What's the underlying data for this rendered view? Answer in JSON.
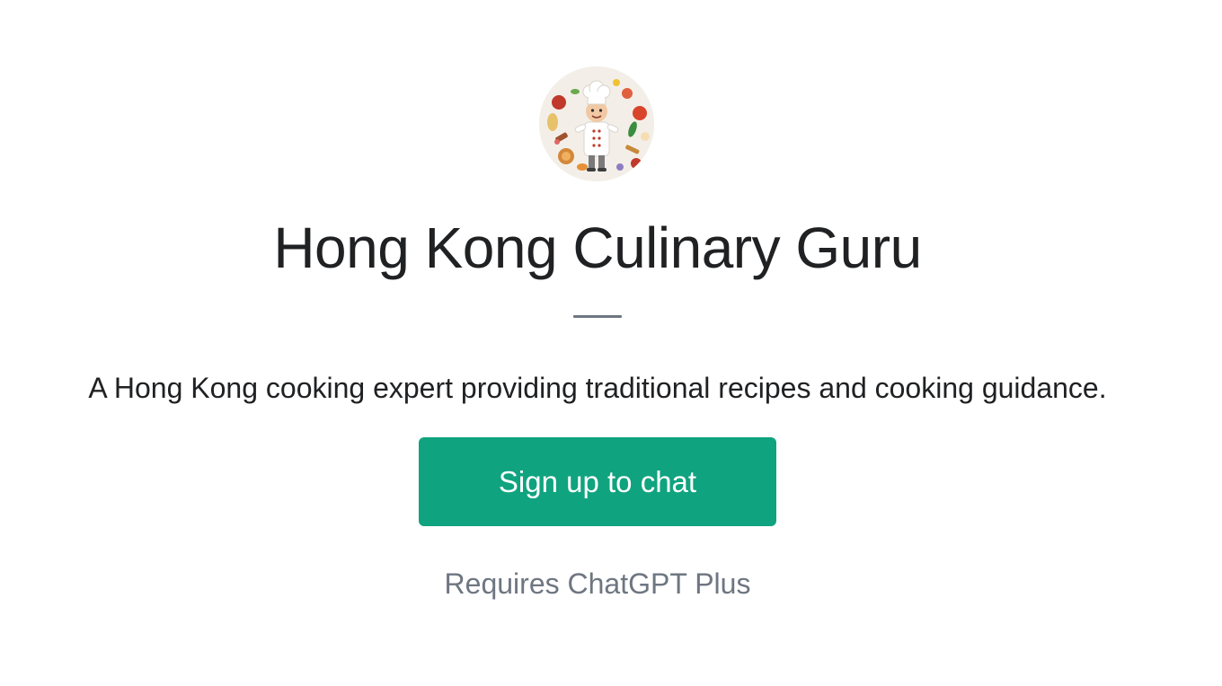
{
  "gpt": {
    "avatar_icon": "chef-illustration-icon",
    "title": "Hong Kong Culinary Guru",
    "description": "A Hong Kong cooking expert providing traditional recipes and cooking guidance.",
    "cta_label": "Sign up to chat",
    "requirement": "Requires ChatGPT Plus"
  },
  "colors": {
    "accent": "#10a37f",
    "text": "#202123",
    "muted": "#6e7681",
    "background": "#ffffff"
  }
}
